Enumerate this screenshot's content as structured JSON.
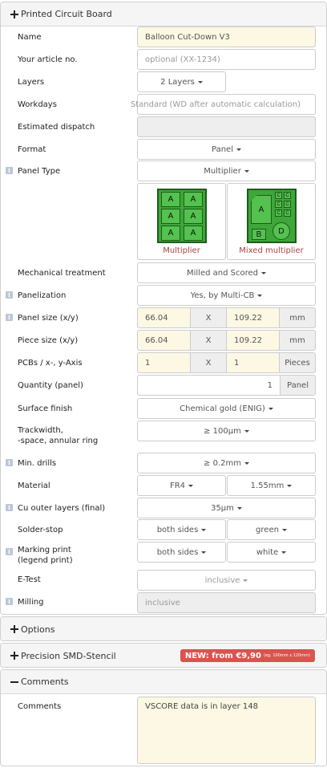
{
  "pcb_panel": {
    "title": "Printed Circuit Board",
    "name": {
      "label": "Name",
      "value": "Balloon Cut-Down V3"
    },
    "article": {
      "label": "Your article no.",
      "placeholder": "optional (XX-1234)"
    },
    "layers": {
      "label": "Layers",
      "value": "2 Layers"
    },
    "workdays": {
      "label": "Workdays",
      "value": "Standard (WD after automatic calculation)"
    },
    "dispatch": {
      "label": "Estimated dispatch",
      "value": ""
    },
    "format": {
      "label": "Format",
      "value": "Panel"
    },
    "panel_type": {
      "label": "Panel Type",
      "value": "Multiplier",
      "options": [
        {
          "caption": "Multiplier"
        },
        {
          "caption": "Mixed multiplier"
        }
      ],
      "multiplier_cells": [
        "A",
        "A",
        "A",
        "A",
        "A",
        "A"
      ],
      "mixed_letters": {
        "big": "A",
        "small": "B",
        "circle": "D",
        "tiny": "C"
      }
    },
    "mechanical": {
      "label": "Mechanical treatment",
      "value": "Milled and Scored"
    },
    "panelization": {
      "label": "Panelization",
      "value": "Yes, by Multi-CB"
    },
    "panel_size": {
      "label": "Panel size (x/y)",
      "x": "66.04",
      "sep": "X",
      "y": "109.22",
      "unit": "mm"
    },
    "piece_size": {
      "label": "Piece size (x/y)",
      "x": "66.04",
      "sep": "X",
      "y": "109.22",
      "unit": "mm"
    },
    "pcbs_axis": {
      "label": "PCBs / x-, y-Axis",
      "x": "1",
      "sep": "X",
      "y": "1",
      "unit": "Pieces"
    },
    "quantity": {
      "label": "Quantity (panel)",
      "value": "1",
      "unit": "Panel"
    },
    "surface": {
      "label": "Surface finish",
      "value": "Chemical gold (ENIG)"
    },
    "trackwidth": {
      "label_1": "Trackwidth,",
      "label_2": "-space, annular ring",
      "value": "≥ 100µm"
    },
    "drills": {
      "label": "Min. drills",
      "value": "≥ 0.2mm"
    },
    "material": {
      "label": "Material",
      "value": "FR4",
      "thickness": "1.55mm"
    },
    "cu_outer": {
      "label": "Cu outer layers (final)",
      "value": "35µm"
    },
    "solder_stop": {
      "label": "Solder-stop",
      "sides": "both sides",
      "color": "green"
    },
    "marking": {
      "label_1": "Marking print",
      "label_2": "(legend print)",
      "sides": "both sides",
      "color": "white"
    },
    "etest": {
      "label": "E-Test",
      "value": "inclusive"
    },
    "milling": {
      "label": "Milling",
      "value": "inclusive"
    }
  },
  "options_panel": {
    "title": "Options"
  },
  "stencil_panel": {
    "title": "Precision SMD-Stencil",
    "badge": "NEW: from €9,90",
    "badge_small": "(eg. 100mm x 120mm)"
  },
  "comments_panel": {
    "title": "Comments",
    "label": "Comments",
    "value": "VSCORE data is in layer 148"
  },
  "colors": {
    "input_highlight": "#fcf8e3",
    "badge": "#d9534f",
    "pcb_green": "#3ea63a",
    "caption": "#a94442"
  }
}
